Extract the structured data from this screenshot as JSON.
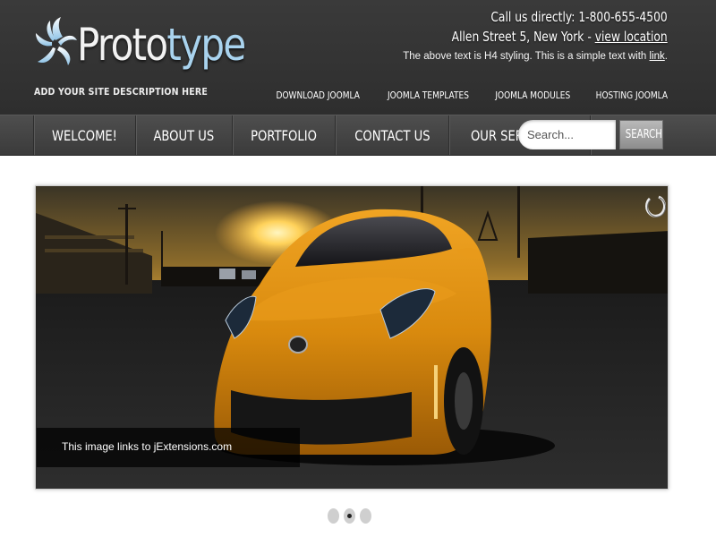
{
  "header": {
    "logo_text": "Prototype",
    "site_description": "ADD YOUR SITE DESCRIPTION HERE",
    "contact": {
      "line1": "Call us directly: 1-800-655-4500",
      "line2_prefix": "Allen Street 5, New York - ",
      "line2_link": "view location",
      "line3_prefix": "The above text is H4 styling. This is a simple text with ",
      "line3_link": "link",
      "line3_suffix": "."
    },
    "top_links": [
      "DOWNLOAD JOOMLA",
      "JOOMLA TEMPLATES",
      "JOOMLA MODULES",
      "HOSTING JOOMLA"
    ]
  },
  "nav": {
    "items": [
      "WELCOME!",
      "ABOUT US",
      "PORTFOLIO",
      "CONTACT US",
      "OUR SERVICES »"
    ]
  },
  "search": {
    "placeholder": "Search...",
    "button_label": "SEARCH"
  },
  "slider": {
    "caption": "This image links to jExtensions.com",
    "slide_count": 3,
    "active_slide": 2
  },
  "colors": {
    "header_bg": "#3a3a3a",
    "nav_bg": "#444444",
    "logo_accent": "#a9d3ee",
    "car_orange": "#e58f10"
  }
}
